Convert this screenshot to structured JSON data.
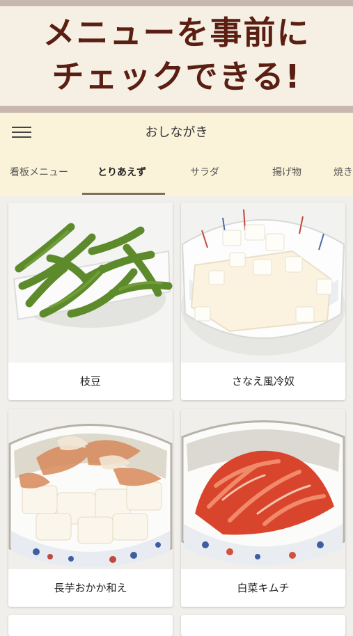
{
  "banner": {
    "line1": "メニューを事前に",
    "line2": "チェックできる!"
  },
  "header": {
    "title": "おしながき",
    "menu_icon": "hamburger-menu-icon"
  },
  "tabs": [
    {
      "label": "看板メニュー"
    },
    {
      "label": "とりあえず",
      "active": true
    },
    {
      "label": "サラダ"
    },
    {
      "label": "揚げ物"
    },
    {
      "label": "焼き"
    }
  ],
  "items": [
    {
      "name": "枝豆"
    },
    {
      "name": "さなえ風冷奴"
    },
    {
      "name": "長芋おかか和え"
    },
    {
      "name": "白菜キムチ"
    }
  ],
  "colors": {
    "banner_text": "#5a1e12",
    "header_bg": "#fbf3d9",
    "page_bg": "#f1efec"
  }
}
